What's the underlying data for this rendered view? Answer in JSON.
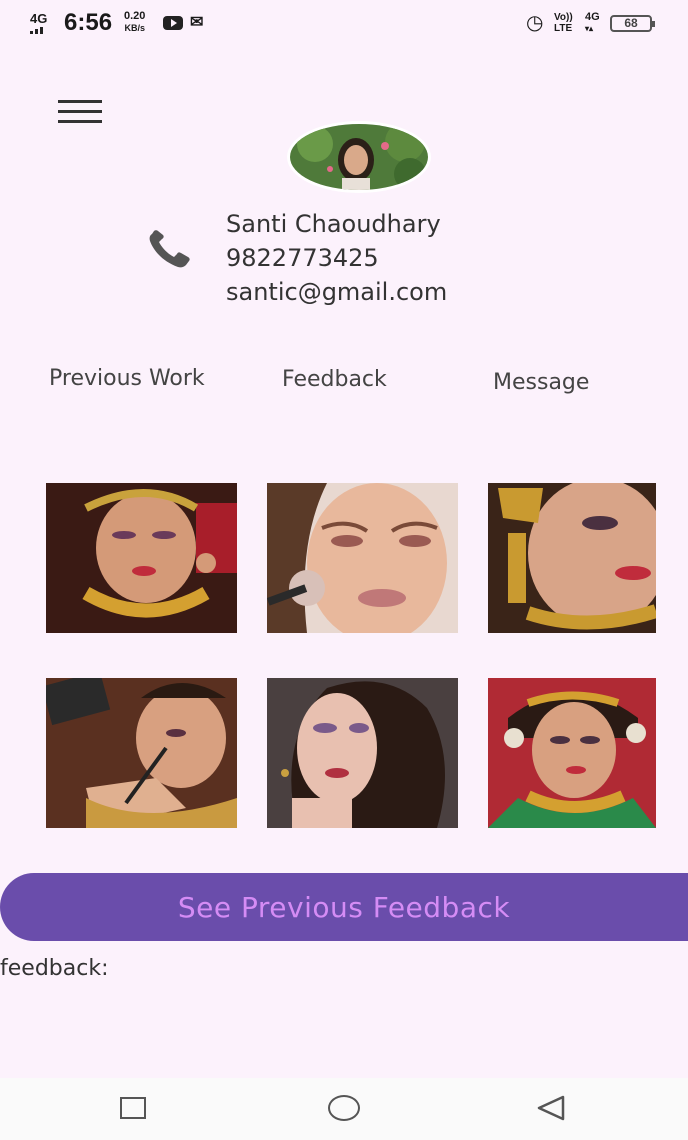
{
  "status_bar": {
    "network": "4G",
    "time": "6:56",
    "speed_value": "0.20",
    "speed_unit": "KB/s",
    "volte_top": "Vo))",
    "volte_bottom": "LTE",
    "network2": "4G",
    "battery": "68"
  },
  "profile": {
    "name": "Santi Chaoudhary",
    "phone": "9822773425",
    "email": "santic@gmail.com"
  },
  "tabs": {
    "previous_work": "Previous Work",
    "feedback": "Feedback",
    "message": "Message"
  },
  "gallery": [
    {
      "icon": "bridal-makeup-photo-1"
    },
    {
      "icon": "glam-makeup-photo-2"
    },
    {
      "icon": "bridal-makeup-photo-3"
    },
    {
      "icon": "makeup-application-photo-4"
    },
    {
      "icon": "glam-makeup-photo-5"
    },
    {
      "icon": "bridal-makeup-photo-6"
    }
  ],
  "see_feedback_button": "See Previous Feedback",
  "feedback_label": "feedback:",
  "colors": {
    "background": "#fcf2fc",
    "button": "#6a4dab",
    "button_text": "#d58cf5"
  }
}
